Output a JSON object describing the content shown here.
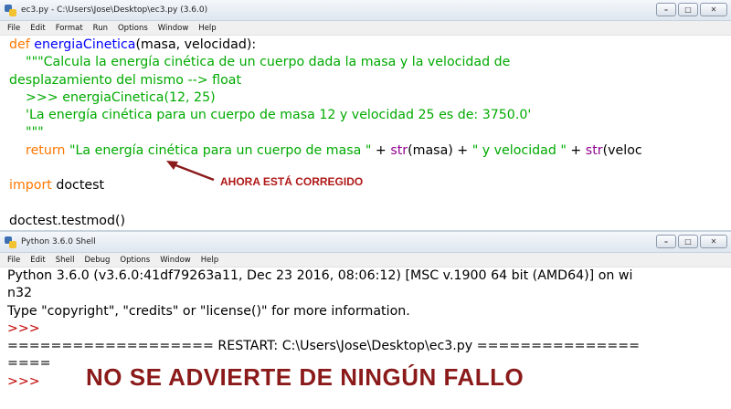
{
  "editor": {
    "title": "ec3.py - C:\\Users\\Jose\\Desktop\\ec3.py (3.6.0)",
    "menu": [
      "File",
      "Edit",
      "Format",
      "Run",
      "Options",
      "Window",
      "Help"
    ],
    "code": {
      "l1_kw": "def",
      "l1_fn": "energiaCinetica",
      "l1_rest": "(masa, velocidad):",
      "l2": "    \"\"\"Calcula la energía cinética de un cuerpo dada la masa y la velocidad de",
      "l3": "desplazamiento del mismo --> float",
      "l4": "    >>> energiaCinetica(12, 25)",
      "l5": "    'La energía cinética para un cuerpo de masa 12 y velocidad 25 es de: 3750.0'",
      "l6": "    \"\"\"",
      "l7_kw": "return",
      "l7_s1": "\"La energía cinética para un cuerpo de masa \"",
      "l7_p1": " + ",
      "l7_b1": "str",
      "l7_p2": "(masa) + ",
      "l7_s2": "\" y velocidad \"",
      "l7_p3": " + ",
      "l7_b2": "str",
      "l7_p4": "(veloc",
      "l9_kw": "import",
      "l9_rest": " doctest",
      "l11": "doctest.testmod()"
    },
    "annotation": "AHORA ESTÁ CORREGIDO",
    "annotation_color": "#b01818"
  },
  "shell": {
    "title": "Python 3.6.0 Shell",
    "menu": [
      "File",
      "Edit",
      "Shell",
      "Debug",
      "Options",
      "Window",
      "Help"
    ],
    "lines": {
      "l1": "Python 3.6.0 (v3.6.0:41df79263a11, Dec 23 2016, 08:06:12) [MSC v.1900 64 bit (AMD64)] on wi",
      "l2": "n32",
      "l3": "Type \"copyright\", \"credits\" or \"license()\" for more information.",
      "prompt": ">>>",
      "l5": "=================== RESTART: C:\\Users\\Jose\\Desktop\\ec3.py ===============",
      "l6": "===="
    },
    "note": "NO SE ADVIERTE DE NINGÚN FALLO",
    "note_color": "#8b1a1a"
  }
}
